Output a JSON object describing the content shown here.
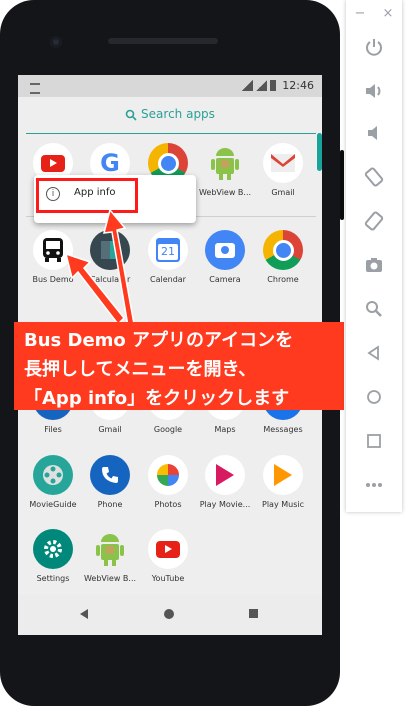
{
  "status_bar": {
    "time": "12:46"
  },
  "launcher": {
    "search_label": "Search apps",
    "apps": [
      {
        "label": "",
        "icon": "youtube-icon"
      },
      {
        "label": "",
        "icon": "google-icon"
      },
      {
        "label": "",
        "icon": "chrome-icon"
      },
      {
        "label": "WebView B...",
        "icon": "android-icon"
      },
      {
        "label": "Gmail",
        "icon": "gmail-icon"
      },
      {
        "label": "Bus Demo",
        "icon": "bus-icon"
      },
      {
        "label": "Calculator",
        "icon": "calculator-icon"
      },
      {
        "label": "Calendar",
        "icon": "calendar-icon"
      },
      {
        "label": "Camera",
        "icon": "camera-icon"
      },
      {
        "label": "Chrome",
        "icon": "chrome-icon"
      },
      {
        "label": "Files",
        "icon": "files-icon"
      },
      {
        "label": "Gmail",
        "icon": "gmail-icon"
      },
      {
        "label": "Google",
        "icon": "google-icon"
      },
      {
        "label": "Maps",
        "icon": "maps-icon"
      },
      {
        "label": "Messages",
        "icon": "messages-icon"
      },
      {
        "label": "MovieGuide",
        "icon": "film-reel-icon"
      },
      {
        "label": "Phone",
        "icon": "phone-icon"
      },
      {
        "label": "Photos",
        "icon": "photos-icon"
      },
      {
        "label": "Play Movie...",
        "icon": "play-movies-icon"
      },
      {
        "label": "Play Music",
        "icon": "play-music-icon"
      },
      {
        "label": "Settings",
        "icon": "settings-icon"
      },
      {
        "label": "WebView B...",
        "icon": "android-icon"
      },
      {
        "label": "YouTube",
        "icon": "youtube-icon"
      }
    ],
    "calendar_day": "21"
  },
  "context_menu": {
    "item_label": "App info",
    "item_icon": "info-icon"
  },
  "annotation": {
    "lines": [
      "Bus Demo アプリのアイコンを",
      "長押ししてメニューを開き、",
      "「App info」をクリックします"
    ],
    "color": "#ff3a1f"
  },
  "emulator_controls": [
    "power-icon",
    "volume-up-icon",
    "volume-down-icon",
    "rotate-left-icon",
    "rotate-right-icon",
    "screenshot-icon",
    "zoom-icon",
    "back-icon",
    "home-icon",
    "overview-icon",
    "more-icon"
  ]
}
